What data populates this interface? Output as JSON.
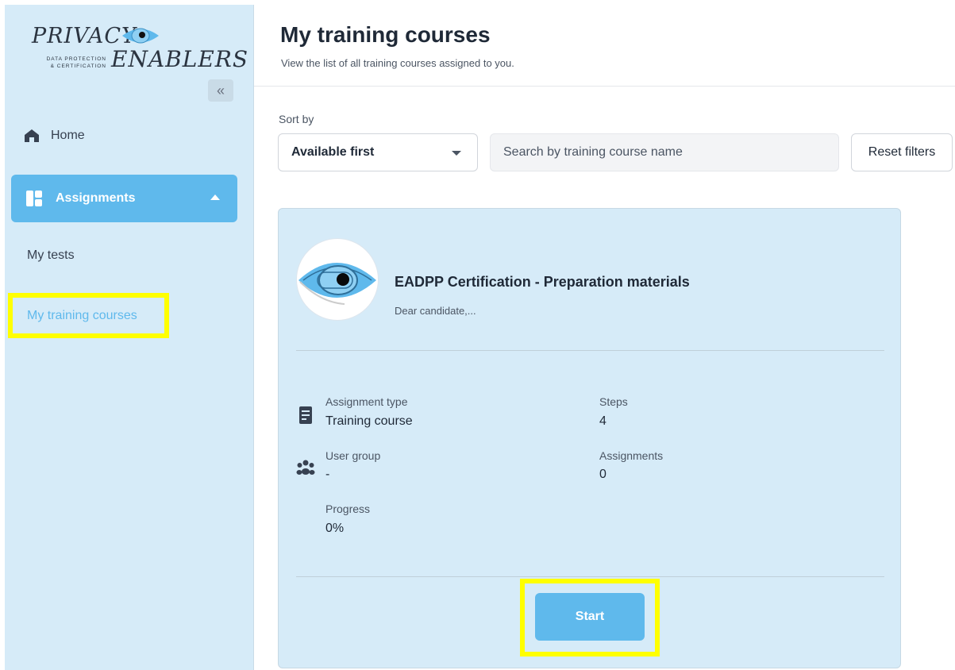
{
  "brand": {
    "line1": "PRIVACY",
    "line2": "ENABLERS",
    "tagline1": "DATA PROTECTION",
    "tagline2": "& CERTIFICATION"
  },
  "sidebar": {
    "collapse_glyph": "«",
    "home_label": "Home",
    "assignments_label": "Assignments",
    "sub_items": [
      {
        "label": "My tests"
      },
      {
        "label": "My training courses"
      }
    ]
  },
  "header": {
    "title": "My training courses",
    "subtitle": "View the list of all training courses assigned to you."
  },
  "filters": {
    "sort_label": "Sort by",
    "sort_value": "Available first",
    "search_placeholder": "Search by training course name",
    "reset_label": "Reset filters"
  },
  "course": {
    "title": "EADPP Certification - Preparation materials",
    "description": "Dear candidate,...",
    "fields": {
      "assignment_type_label": "Assignment type",
      "assignment_type_value": "Training course",
      "steps_label": "Steps",
      "steps_value": "4",
      "user_group_label": "User group",
      "user_group_value": "-",
      "assignments_label": "Assignments",
      "assignments_value": "0",
      "progress_label": "Progress",
      "progress_value": "0%"
    },
    "start_label": "Start"
  },
  "colors": {
    "accent": "#5fb9ec",
    "sidebar_bg": "#d6ebf8",
    "highlight": "#ffff00"
  }
}
